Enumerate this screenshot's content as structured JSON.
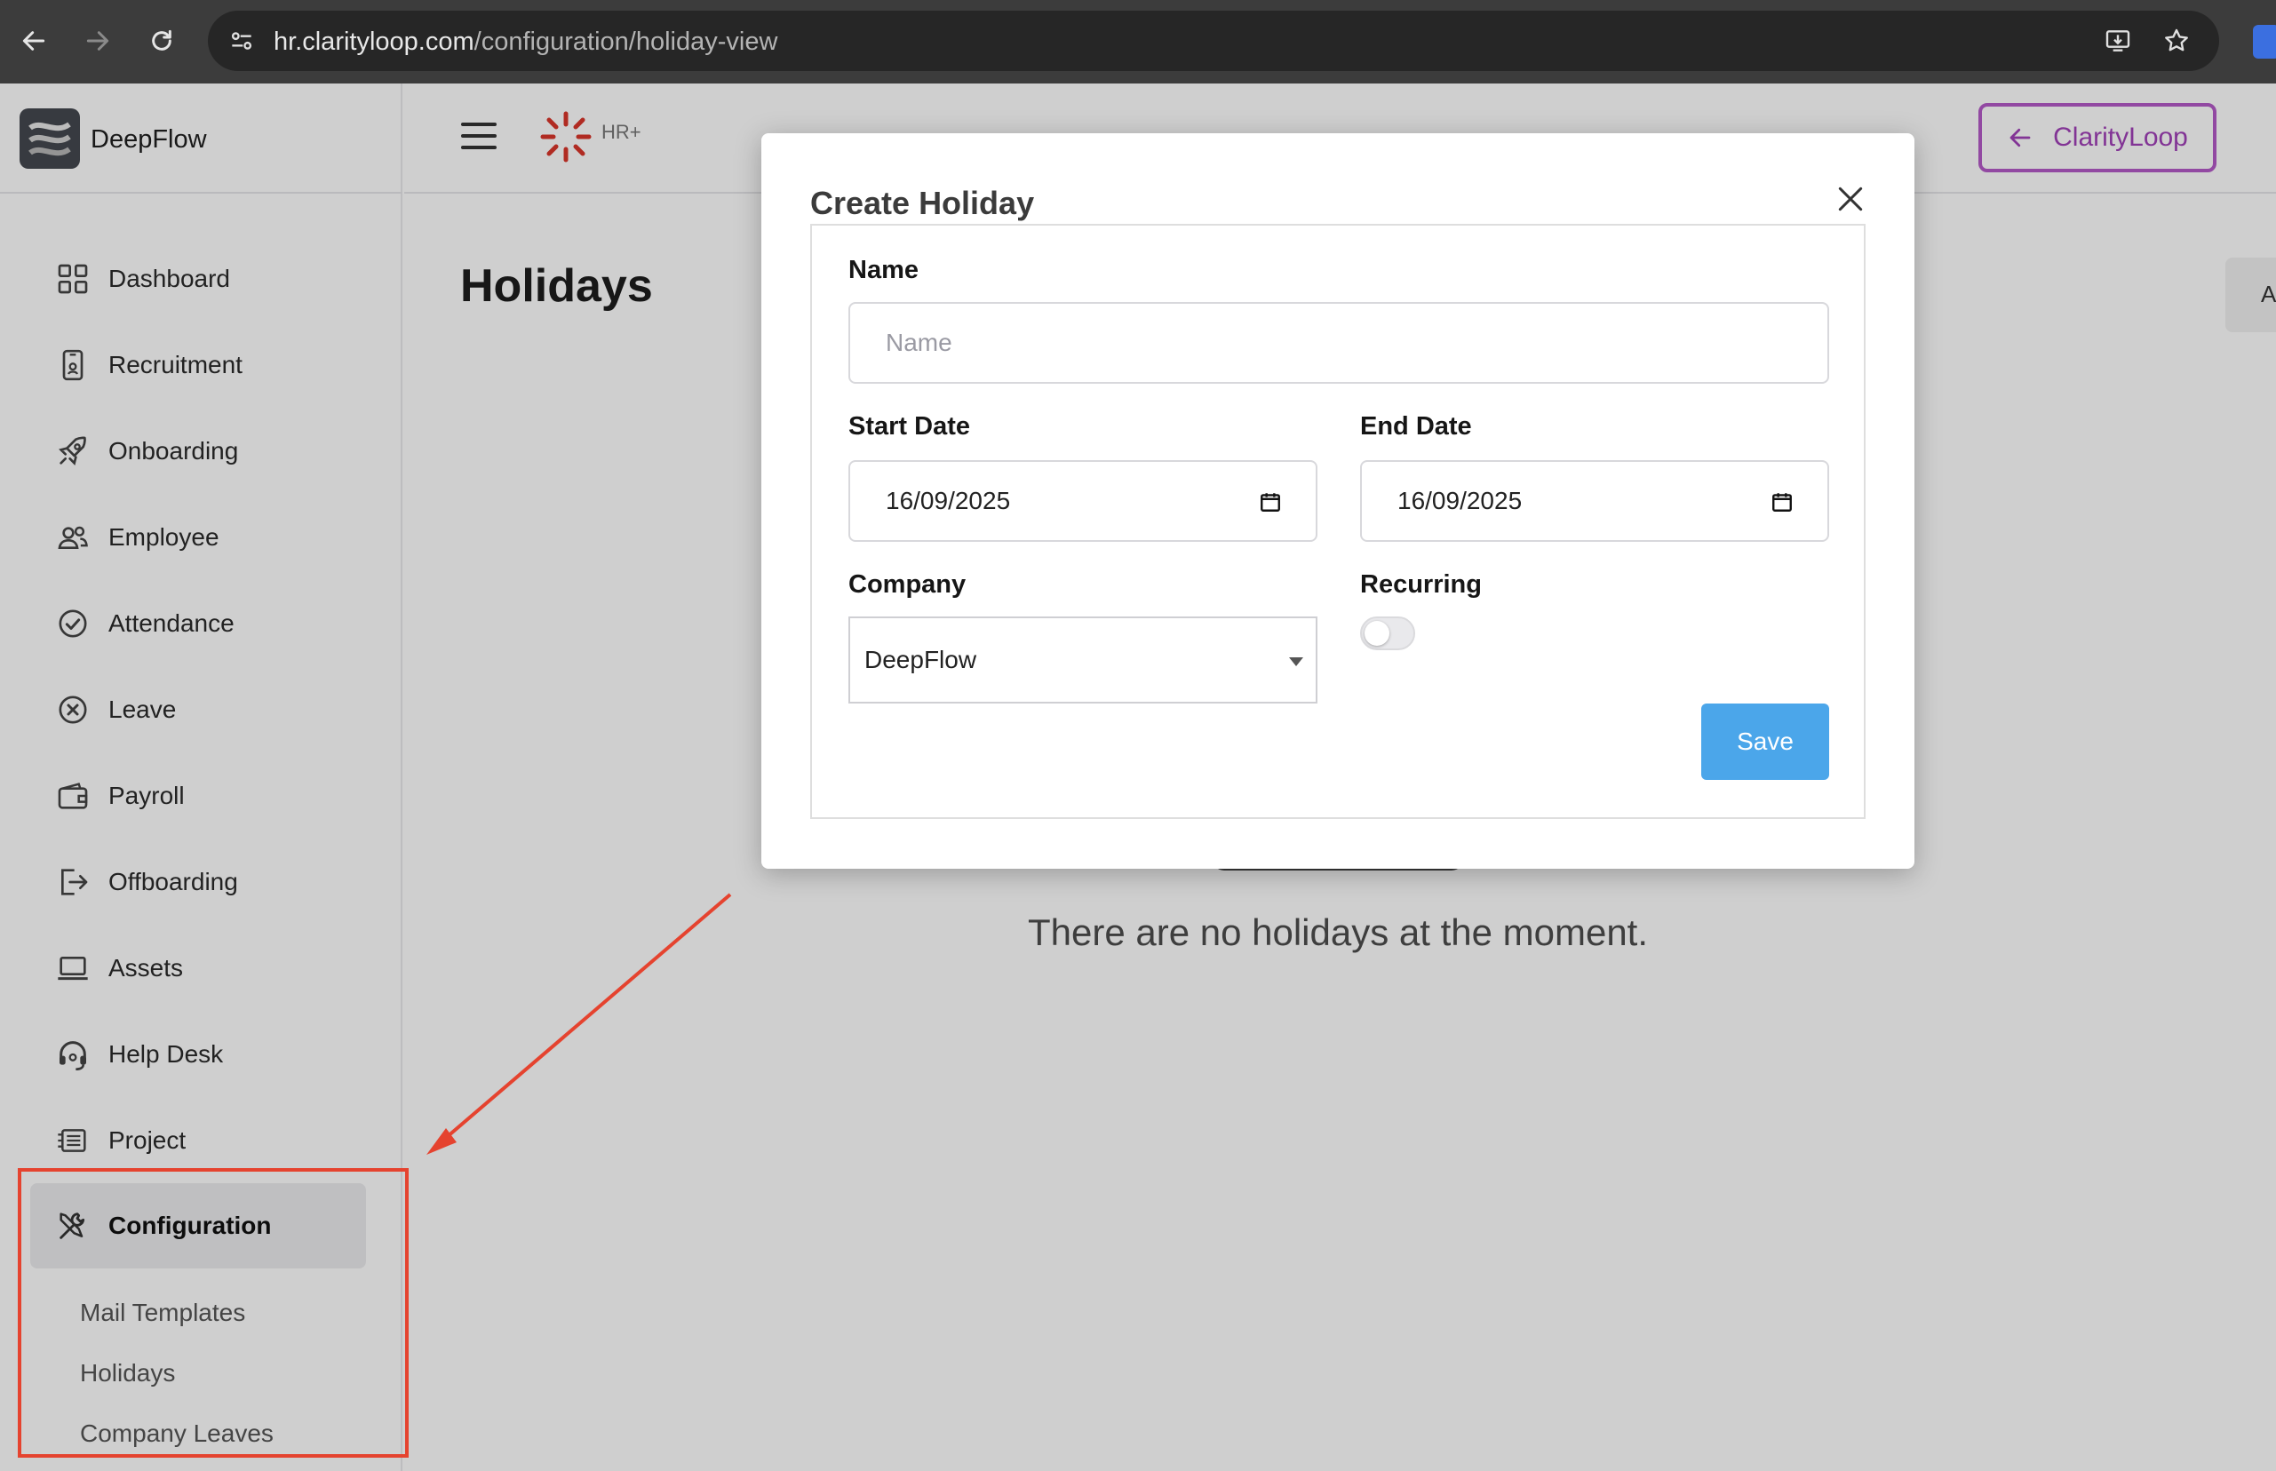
{
  "browser": {
    "url_host": "hr.clarityloop.com",
    "url_path": "/configuration/holiday-view"
  },
  "brand": {
    "name": "DeepFlow"
  },
  "topbar": {
    "hr_label": "HR+",
    "clarityloop_label": "ClarityLoop",
    "edge_label": "A"
  },
  "sidebar": {
    "items": [
      {
        "label": "Dashboard",
        "icon": "dashboard-icon"
      },
      {
        "label": "Recruitment",
        "icon": "phone-badge-icon"
      },
      {
        "label": "Onboarding",
        "icon": "rocket-icon"
      },
      {
        "label": "Employee",
        "icon": "people-icon"
      },
      {
        "label": "Attendance",
        "icon": "check-circle-icon"
      },
      {
        "label": "Leave",
        "icon": "x-circle-icon"
      },
      {
        "label": "Payroll",
        "icon": "wallet-icon"
      },
      {
        "label": "Offboarding",
        "icon": "logout-icon"
      },
      {
        "label": "Assets",
        "icon": "laptop-icon"
      },
      {
        "label": "Help Desk",
        "icon": "headset-icon"
      },
      {
        "label": "Project",
        "icon": "project-icon"
      },
      {
        "label": "Configuration",
        "icon": "tools-icon"
      }
    ],
    "sub_items": [
      "Mail Templates",
      "Holidays",
      "Company Leaves"
    ]
  },
  "main": {
    "title": "Holidays",
    "empty_message": "There are no holidays at the moment."
  },
  "modal": {
    "title": "Create Holiday",
    "name_label": "Name",
    "name_placeholder": "Name",
    "start_date_label": "Start Date",
    "start_date_value": "16/09/2025",
    "end_date_label": "End Date",
    "end_date_value": "16/09/2025",
    "company_label": "Company",
    "company_value": "DeepFlow",
    "recurring_label": "Recurring",
    "recurring_on": false,
    "save_label": "Save"
  },
  "colors": {
    "accent_blue": "#4ba6ea",
    "clarityloop_purple": "#a040b8",
    "annotation_red": "#e5432f",
    "hr_logo_red": "#d9352b"
  }
}
